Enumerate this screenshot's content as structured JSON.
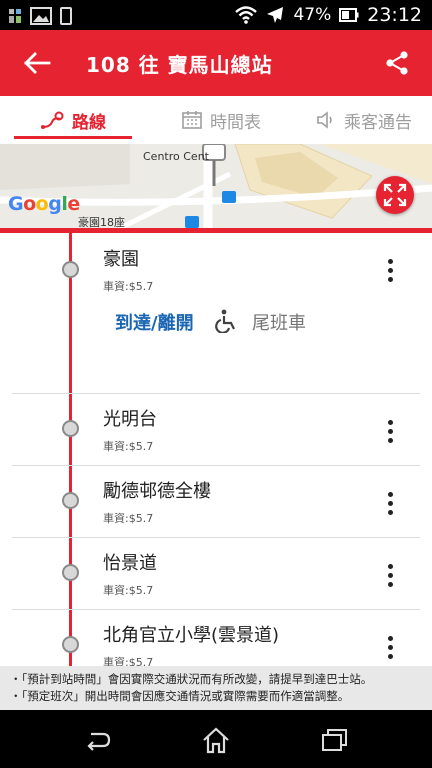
{
  "status_bar": {
    "battery": "47%",
    "time": "23:12",
    "icons": [
      "notification-icon",
      "image-icon",
      "sim-icon",
      "wifi-icon",
      "airplane-icon",
      "battery-icon"
    ]
  },
  "app_bar": {
    "title": "108 往 寶馬山總站",
    "back_icon": "arrow-back-icon",
    "share_icon": "share-icon",
    "color": "#e52331"
  },
  "tabs": [
    {
      "label": "路線",
      "icon": "route-icon",
      "active": true
    },
    {
      "label": "時間表",
      "icon": "calendar-icon",
      "active": false
    },
    {
      "label": "乘客通告",
      "icon": "speaker-icon",
      "active": false
    }
  ],
  "map": {
    "labels": [
      "Centro Cent",
      "豪園18座"
    ],
    "logo": "Google",
    "expand_icon": "fullscreen-icon"
  },
  "stops": [
    {
      "name": "豪園",
      "fare": "車資:$5.7",
      "expanded": true,
      "arrive_label": "到達/離開",
      "accessibility_icon": "wheelchair-icon",
      "last_bus_label": "尾班車"
    },
    {
      "name": "光明台",
      "fare": "車資:$5.7"
    },
    {
      "name": "勵德邨德全樓",
      "fare": "車資:$5.7"
    },
    {
      "name": "怡景道",
      "fare": "車資:$5.7"
    },
    {
      "name": "北角官立小學(雲景道)",
      "fare": "車資:$5.7"
    }
  ],
  "notes": [
    "・「預計到站時間」會因實際交通狀況而有所改變，請提早到達巴士站。",
    "・「預定班次」開出時間會因應交通情況或實際需要而作適當調整。"
  ],
  "nav_bar": {
    "icons": [
      "back-nav-icon",
      "home-nav-icon",
      "recents-nav-icon"
    ]
  }
}
